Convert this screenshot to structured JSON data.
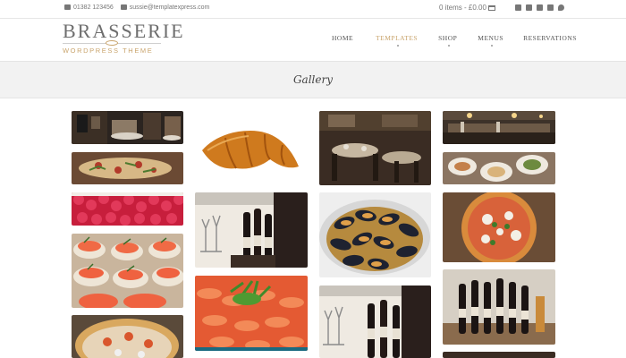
{
  "topbar": {
    "phone": "01382 123456",
    "email": "sussie@templatexpress.com",
    "cart_text": "0 items - £0.00",
    "social_icons": [
      "email-icon",
      "google-plus-icon",
      "linkedin-icon",
      "facebook-icon",
      "twitter-icon"
    ]
  },
  "logo": {
    "brand": "BRASSERIE",
    "subtitle": "WORDPRESS THEME"
  },
  "nav": {
    "items": [
      {
        "label": "HOME"
      },
      {
        "label": "TEMPLATES",
        "active": true
      },
      {
        "label": "SHOP"
      },
      {
        "label": "MENUS"
      },
      {
        "label": "RESERVATIONS"
      }
    ]
  },
  "page": {
    "title": "Gallery"
  },
  "gallery": {
    "images": [
      {
        "name": "gallery-image-restaurant-interior"
      },
      {
        "name": "gallery-image-croissant"
      },
      {
        "name": "gallery-image-dining-room"
      },
      {
        "name": "gallery-image-bar-counter"
      },
      {
        "name": "gallery-image-flatbread-pizza"
      },
      {
        "name": "gallery-image-table-dishes"
      },
      {
        "name": "gallery-image-raspberries"
      },
      {
        "name": "gallery-image-wine-glasses"
      },
      {
        "name": "gallery-image-mussels"
      },
      {
        "name": "gallery-image-pizza"
      },
      {
        "name": "gallery-image-salmon-canapes"
      },
      {
        "name": "gallery-image-prawns"
      },
      {
        "name": "gallery-image-wine-bar"
      },
      {
        "name": "gallery-image-wine-bottles"
      },
      {
        "name": "gallery-image-seafood-pizza"
      }
    ]
  },
  "colors": {
    "accent": "#c9a46c",
    "band": "#f2f2f2",
    "text": "#555555"
  }
}
